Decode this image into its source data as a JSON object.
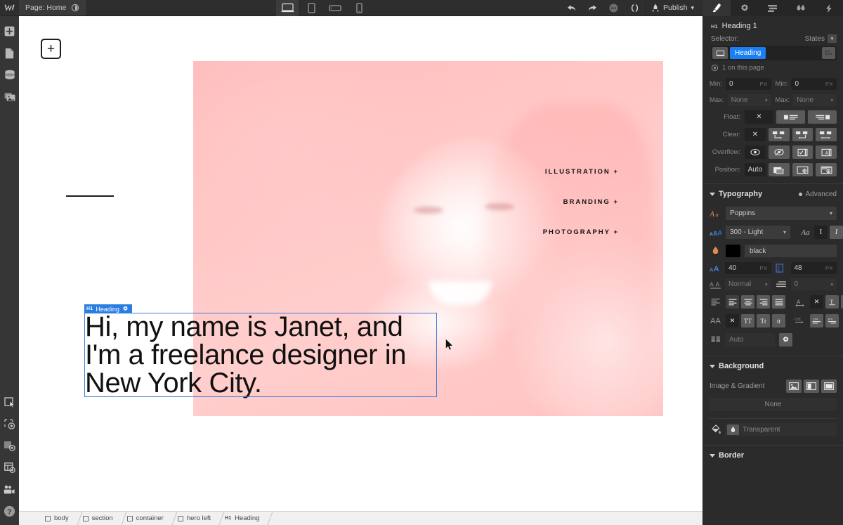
{
  "topbar": {
    "logo": "W",
    "page_label": "Page: Home",
    "eye_icon": "preview-eye-icon",
    "devices": [
      {
        "name": "desktop",
        "icon": "desktop-icon",
        "active": true
      },
      {
        "name": "tablet",
        "icon": "tablet-icon",
        "active": false
      },
      {
        "name": "mobile-landscape",
        "icon": "mobile-landscape-icon",
        "active": false
      },
      {
        "name": "mobile-portrait",
        "icon": "mobile-portrait-icon",
        "active": false
      }
    ],
    "undo_icon": "undo-arrow-icon",
    "redo_icon": "redo-arrow-icon",
    "comment_icon": "comment-bubble-icon",
    "code_icon": "code-brackets-icon",
    "publish_icon": "rocket-icon",
    "publish_label": "Publish",
    "publish_caret": "⌄"
  },
  "panel_tabs": [
    {
      "name": "style-tab",
      "icon": "paint-brush-icon",
      "active": true
    },
    {
      "name": "settings-tab",
      "icon": "gear-icon",
      "active": false
    },
    {
      "name": "navigator-tab",
      "icon": "layers-icon",
      "active": false
    },
    {
      "name": "interactions-tab",
      "icon": "droplets-icon",
      "active": false
    },
    {
      "name": "effects-tab",
      "icon": "lightning-icon",
      "active": false
    }
  ],
  "leftbar": {
    "top_items": [
      {
        "name": "add-elements",
        "icon": "plus-icon"
      },
      {
        "name": "pages",
        "icon": "page-icon"
      },
      {
        "name": "cms-collections",
        "icon": "database-icon"
      },
      {
        "name": "assets",
        "icon": "assets-images-icon"
      }
    ],
    "bottom_items": [
      {
        "name": "select-tool",
        "icon": "cursor-select-icon"
      },
      {
        "name": "element-outlines",
        "icon": "dashed-box-eye-icon"
      },
      {
        "name": "guides",
        "icon": "guides-eye-icon"
      },
      {
        "name": "layout-preview",
        "icon": "layout-eye-icon"
      },
      {
        "name": "video-tutorials",
        "icon": "video-camera-icon"
      },
      {
        "name": "help",
        "icon": "question-mark-icon"
      }
    ]
  },
  "canvas": {
    "logo_plus": "+",
    "nav_links": [
      "ILLUSTRATION +",
      "BRANDING +",
      "PHOTOGRAPHY +"
    ],
    "heading_text": "Hi, my name is Janet, and I'm a freelance designer in New York City.",
    "selection_badge": {
      "tag": "H1",
      "label": "Heading",
      "gear_icon": "gear-icon"
    },
    "hero_image_alt": "pink-tinted-portrait-photo",
    "hero_image_tint": "#ffc4c2"
  },
  "style_panel": {
    "element_tag": "H1",
    "element_name": "Heading 1",
    "selector_label": "Selector:",
    "states_label": "States",
    "selector_device_icon": "desktop-icon",
    "selector_chip": "Heading",
    "selector_more_icon": "selector-options-icon",
    "on_this_page": "1 on this page",
    "on_this_page_icon": "eye-count-icon",
    "size_rows": [
      {
        "label": "Min:",
        "value": "0",
        "unit": "PX",
        "placeholder": "0"
      },
      {
        "label": "Min:",
        "value": "0",
        "unit": "PX",
        "placeholder": "0"
      },
      {
        "label": "Max:",
        "value": "None",
        "unit": "",
        "placeholder": "None"
      },
      {
        "label": "Max:",
        "value": "None",
        "unit": "",
        "placeholder": "None"
      }
    ],
    "float": {
      "label": "Float:",
      "options": [
        "none-x",
        "float-left",
        "float-right"
      ],
      "active": 0
    },
    "clear": {
      "label": "Clear:",
      "options": [
        "none-x",
        "clear-left",
        "clear-right",
        "clear-both"
      ],
      "active": 0
    },
    "overflow": {
      "label": "Overflow:",
      "options": [
        "visible-eye",
        "hidden-eye-slash",
        "scroll-box",
        "auto-box"
      ],
      "active": 0
    },
    "position": {
      "label": "Position:",
      "options": [
        "Auto",
        "relative",
        "absolute",
        "fixed"
      ],
      "active": 0
    },
    "typography": {
      "title": "Typography",
      "advanced": "Advanced",
      "font_family": "Poppins",
      "font_family_icon": "font-family-icon",
      "font_weight": "300 - Light",
      "font_weight_icon": "font-weight-icon",
      "italic_caps_icons": [
        "Aa",
        "I",
        "I"
      ],
      "color_icon": "text-color-icon",
      "color_value": "black",
      "font_size_icon": "font-size-icon",
      "font_size": "40",
      "font_size_unit": "PX",
      "line_height_icon": "line-height-icon",
      "line_height": "48",
      "line_height_unit": "PX",
      "letter_spacing_icon": "letter-spacing-icon",
      "letter_spacing": "Normal",
      "indent_icon": "text-indent-icon",
      "indent": "0",
      "align_icon": "text-align-icon",
      "align_options": [
        "align-left",
        "align-center",
        "align-right",
        "align-justify"
      ],
      "align_active": 0,
      "decoration_icon": "text-decoration-icon",
      "decoration_options": [
        "none-x",
        "underline",
        "strikethrough"
      ],
      "decoration_active": 0,
      "transform_icon": "text-transform-icon",
      "transform_options": [
        "none-x",
        "uppercase",
        "capitalize",
        "lowercase"
      ],
      "transform_active": 0,
      "direction_icon": "text-direction-icon",
      "direction_options": [
        "ltr",
        "rtl"
      ],
      "direction_active": 0,
      "columns_icon": "columns-icon",
      "columns_value": "Auto",
      "columns_settings_icon": "gear-icon"
    },
    "background": {
      "title": "Background",
      "image_gradient_label": "Image & Gradient",
      "image_icon": "image-icon",
      "gradient_icon": "gradient-icon",
      "overlay_icon": "overlay-icon",
      "none_value": "None",
      "bucket_icon": "paint-bucket-icon",
      "droplet_icon": "droplet-icon",
      "color_value": "Transparent"
    },
    "border": {
      "title": "Border"
    }
  },
  "breadcrumb": [
    {
      "icon": "body-icon",
      "label": "body"
    },
    {
      "icon": "box-icon",
      "label": "section"
    },
    {
      "icon": "box-icon",
      "label": "container"
    },
    {
      "icon": "box-icon",
      "label": "hero left"
    },
    {
      "icon": "h1-icon",
      "label": "Heading"
    }
  ]
}
